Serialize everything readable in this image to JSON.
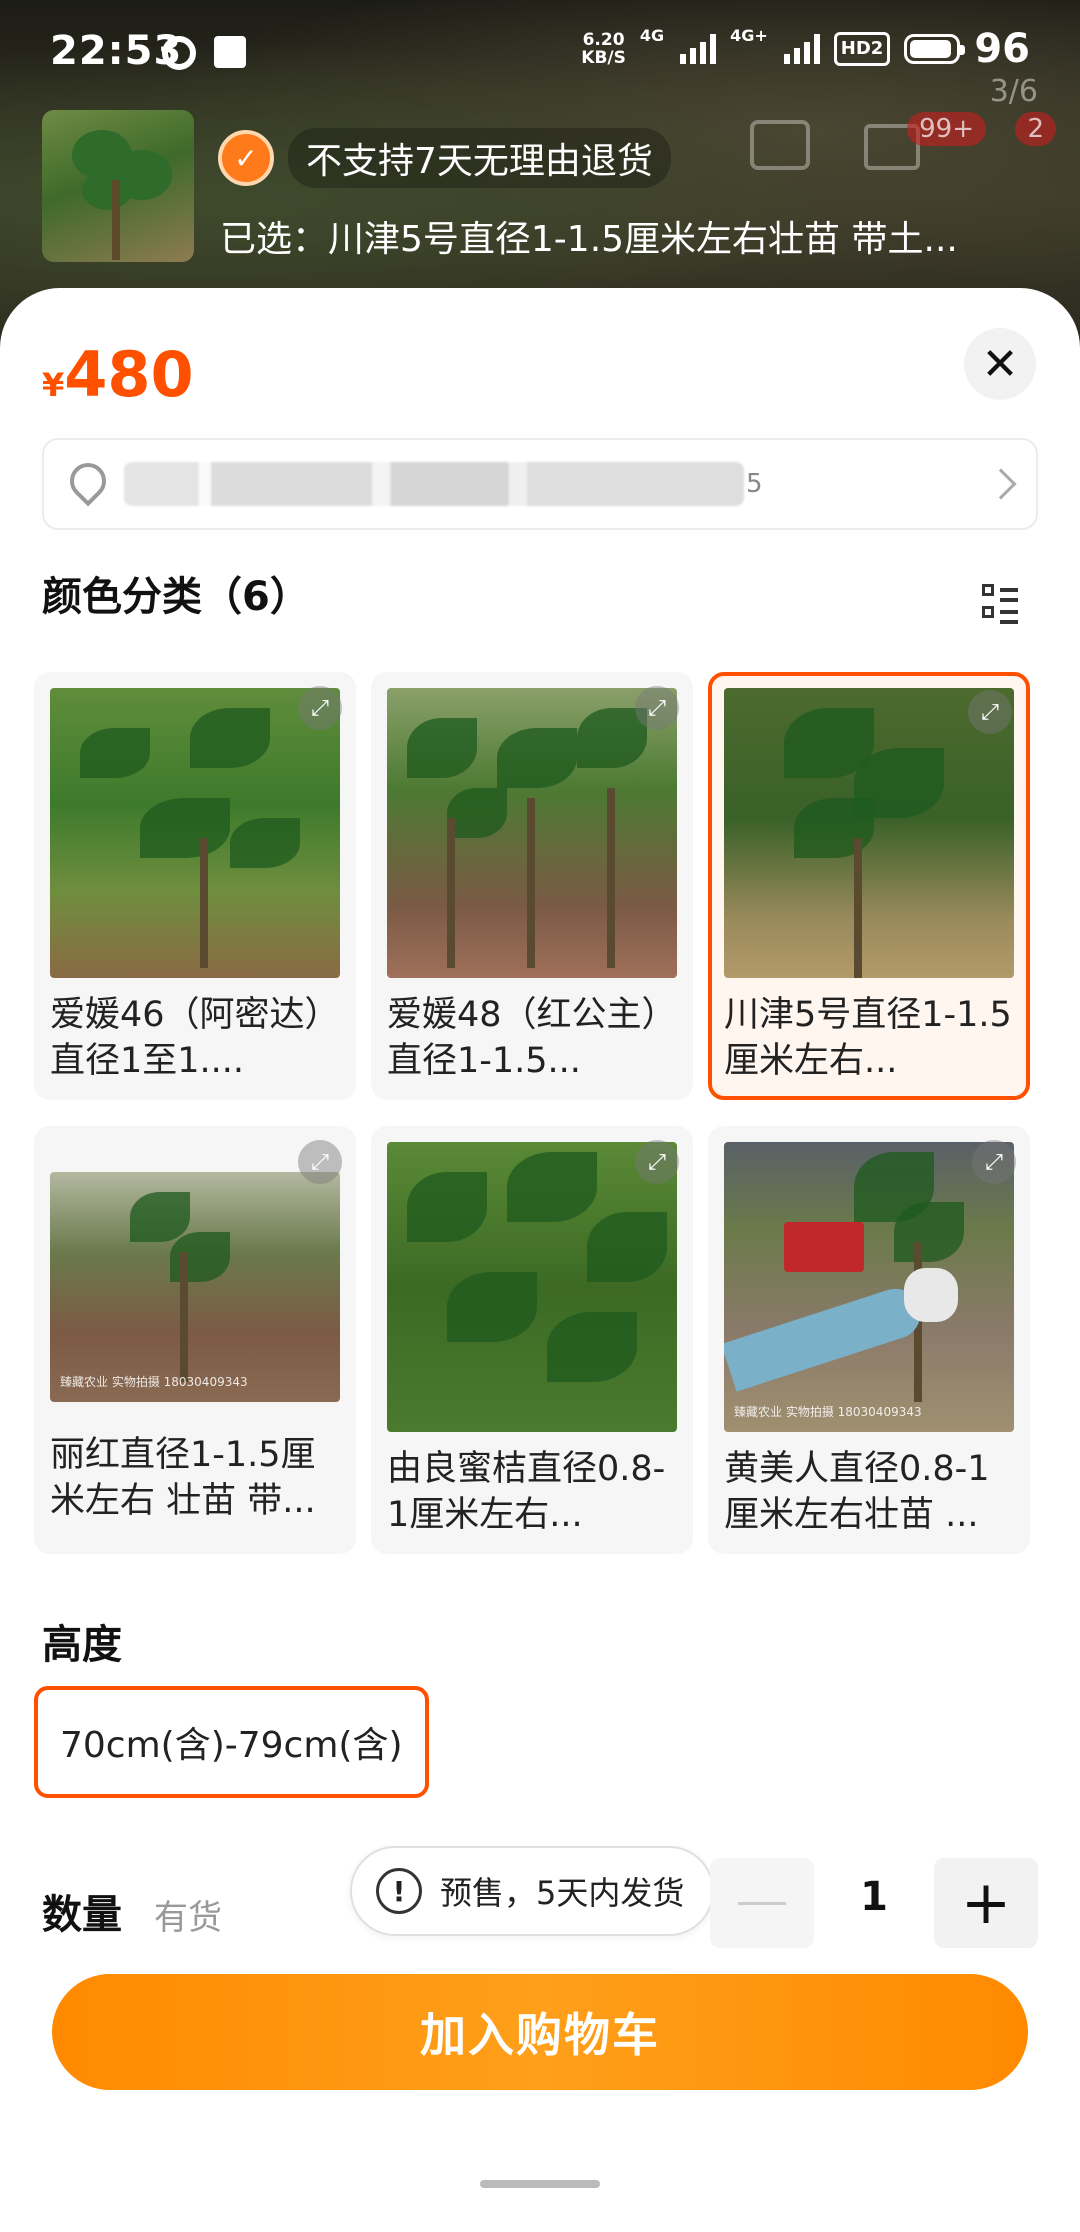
{
  "status_bar": {
    "time": "22:53",
    "net_speed_value": "6.20",
    "net_speed_unit": "KB/S",
    "signal_1": "4G",
    "signal_2": "4G+",
    "hd_label": "HD2",
    "battery_level": "96"
  },
  "header": {
    "page_indicator": "3/6",
    "cart_badge": "99+",
    "msg_badge": "2",
    "return_policy": "不支持7天无理由退货",
    "selected_text": "已选：川津5号直径1-1.5厘米左右壮苗 带土..."
  },
  "price": {
    "currency": "¥",
    "amount": "480"
  },
  "address": {
    "tail_visible": "5"
  },
  "color_section": {
    "title": "颜色分类（6）",
    "options": [
      {
        "label": "爱媛46（阿密达）直径1至1....",
        "selected": false
      },
      {
        "label": "爱媛48（红公主）直径1-1.5...",
        "selected": false
      },
      {
        "label": "川津5号直径1-1.5厘米左右...",
        "selected": true
      },
      {
        "label": "丽红直径1-1.5厘米左右 壮苗 带...",
        "selected": false
      },
      {
        "label": "由良蜜桔直径0.8-1厘米左右...",
        "selected": false
      },
      {
        "label": "黄美人直径0.8-1厘米左右壮苗 ...",
        "selected": false
      }
    ],
    "photo_note_4": "臻藏农业 实物拍摄 18030409343",
    "photo_note_6": "臻藏农业 实物拍摄 18030409343"
  },
  "height_section": {
    "title": "高度",
    "option": "70cm(含)-79cm(含)"
  },
  "quantity_section": {
    "title": "数量",
    "stock": "有货",
    "presale": "预售，5天内发货",
    "value": "1",
    "minus": "—",
    "plus": "+"
  },
  "actions": {
    "add_to_cart": "加入购物车"
  },
  "colors": {
    "accent": "#ff5000",
    "button": "#ff8a00"
  }
}
